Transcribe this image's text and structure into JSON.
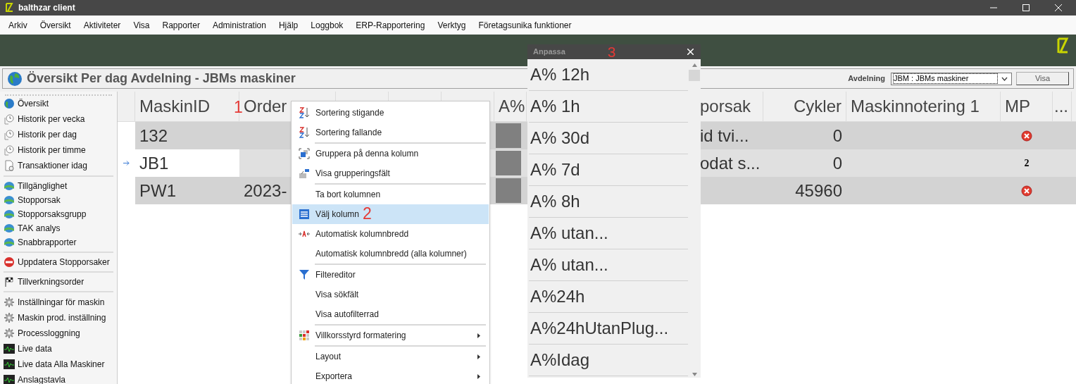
{
  "window": {
    "title": "balthzar client"
  },
  "menu_bar": [
    "Arkiv",
    "Översikt",
    "Aktiviteter",
    "Visa",
    "Rapporter",
    "Administration",
    "Hjälp",
    "Loggbok",
    "ERP-Rapportering",
    "Verktyg",
    "Företagsunika funktioner"
  ],
  "page_header": {
    "title": "Översikt Per dag Avdelning - JBMs maskiner",
    "filter_label": "Avdelning",
    "filter_value": "JBM : JBMs maskiner",
    "button": "Visa"
  },
  "sidebar": {
    "groups": [
      [
        "Översikt",
        "Historik per vecka",
        "Historik per dag",
        "Historik per timme",
        "Transaktioner idag"
      ],
      [
        "Tillgänglighet",
        "Stopporsak",
        "Stopporsaksgrupp",
        "TAK analys",
        "Snabbrapporter"
      ],
      [
        "Uppdatera Stopporsaker"
      ],
      [
        "Tillverkningsorder"
      ],
      [
        "Inställningar för maskin",
        "Maskin prod. inställning",
        "Processloggning",
        "Live data",
        "Live data Alla Maskiner",
        "Anslagstavla"
      ]
    ]
  },
  "grid": {
    "columns": {
      "maskin_id": "MaskinID",
      "order": "Order",
      "a_pct": "A%",
      "stop": "porsak",
      "cykler": "Cykler",
      "note": "Maskinnotering 1",
      "mp": "MP",
      "more": "..."
    },
    "rows": [
      {
        "maskin_id": "132",
        "order": "",
        "stop": "id tvi...",
        "cykler": "0",
        "mp": {
          "kind": "error"
        },
        "selected": false
      },
      {
        "maskin_id": "JB1",
        "order": "",
        "stop": "odat s...",
        "cykler": "0",
        "mp": {
          "kind": "text",
          "text": "2"
        },
        "selected": true
      },
      {
        "maskin_id": "PW1",
        "order": "2023-",
        "stop": "",
        "cykler": "45960",
        "mp": {
          "kind": "error"
        },
        "selected": false
      }
    ]
  },
  "context_menu": {
    "groups": [
      [
        {
          "label": "Sortering stigande",
          "submenu": false,
          "selected": false
        },
        {
          "label": "Sortering fallande",
          "submenu": false,
          "selected": false
        }
      ],
      [
        {
          "label": "Gruppera på denna kolumn",
          "submenu": false,
          "selected": false
        },
        {
          "label": "Visa grupperingsfält",
          "submenu": false,
          "selected": false
        }
      ],
      [
        {
          "label": "Ta bort kolumnen",
          "submenu": false,
          "selected": false
        },
        {
          "label": "Välj kolumn",
          "submenu": false,
          "selected": true
        },
        {
          "label": "Automatisk kolumnbredd",
          "submenu": false,
          "selected": false
        },
        {
          "label": "Automatisk kolumnbredd (alla kolumner)",
          "submenu": false,
          "selected": false
        }
      ],
      [
        {
          "label": "Filtereditor",
          "submenu": false,
          "selected": false
        },
        {
          "label": "Visa sökfält",
          "submenu": false,
          "selected": false
        },
        {
          "label": "Visa autofilterrad",
          "submenu": false,
          "selected": false
        }
      ],
      [
        {
          "label": "Villkorsstyrd formatering",
          "submenu": true,
          "selected": false
        }
      ],
      [
        {
          "label": "Layout",
          "submenu": true,
          "selected": false
        },
        {
          "label": "Exportera",
          "submenu": true,
          "selected": false
        }
      ]
    ]
  },
  "customize_panel": {
    "title": "Anpassa",
    "items": [
      "A% 12h",
      "A% 1h",
      "A% 30d",
      "A% 7d",
      "A% 8h",
      "A% utan...",
      "A% utan...",
      "A%24h",
      "A%24hUtanPlug...",
      "A%Idag"
    ]
  },
  "annotations": [
    "1",
    "2",
    "3"
  ]
}
